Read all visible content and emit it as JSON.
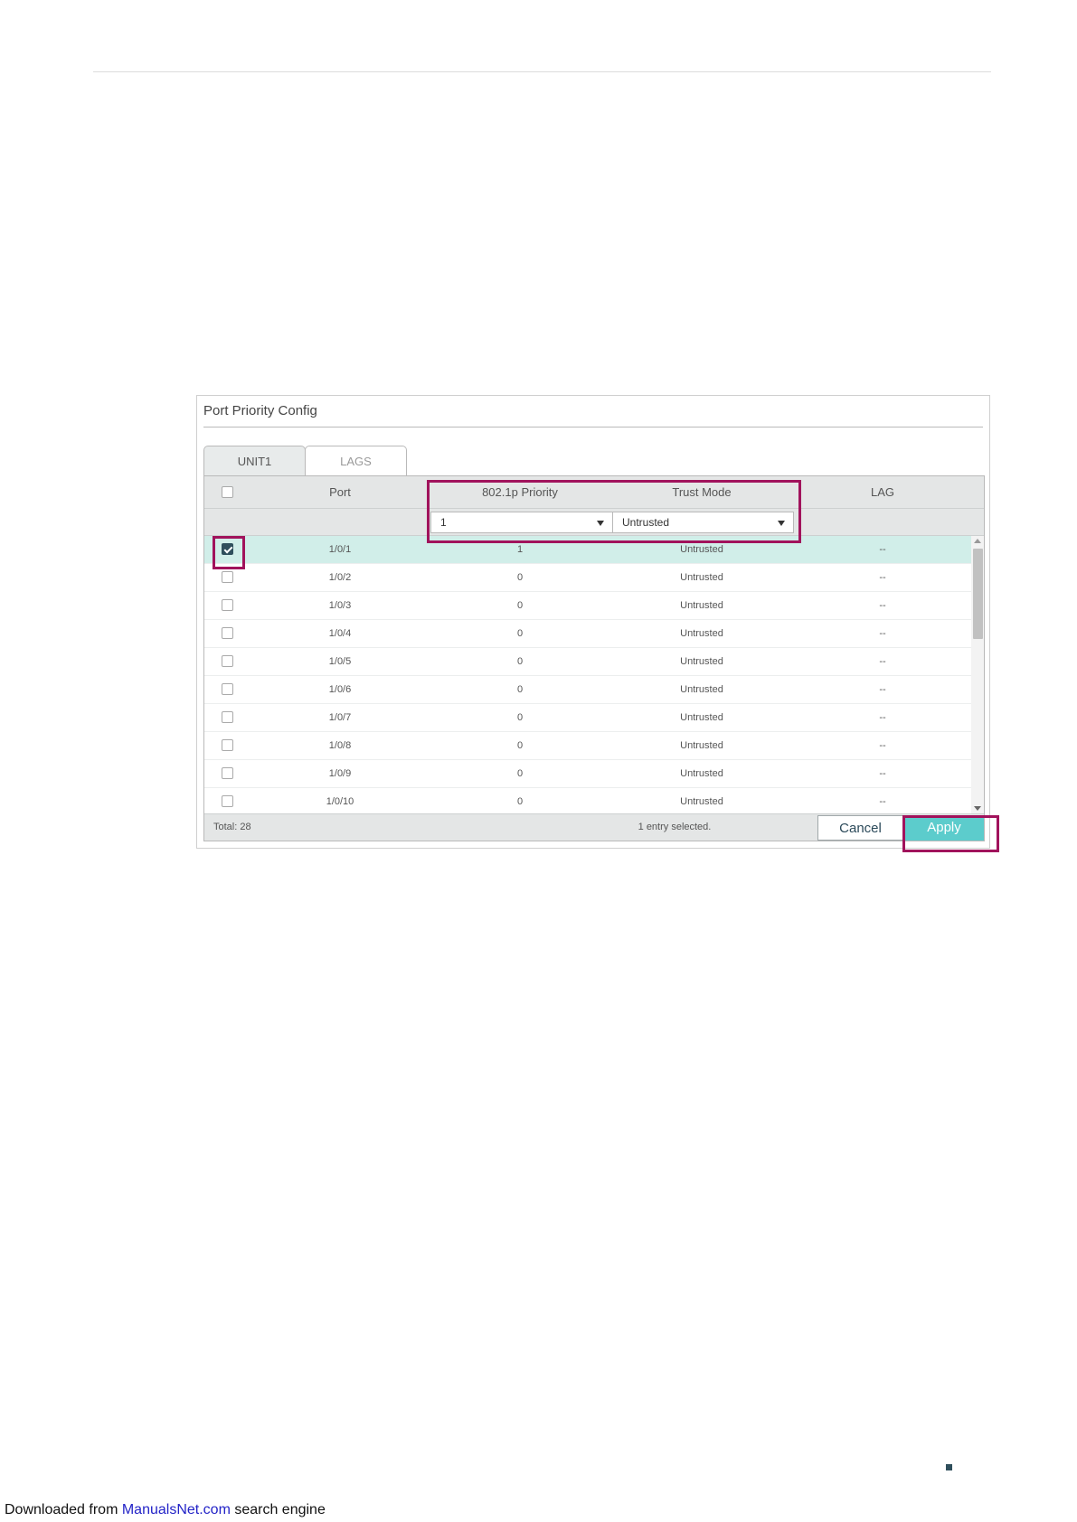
{
  "panel": {
    "title": "Port Priority Config"
  },
  "tabs": [
    {
      "label": "UNIT1",
      "active": true
    },
    {
      "label": "LAGS",
      "active": false
    }
  ],
  "columns": {
    "port": "Port",
    "priority": "802.1p Priority",
    "trust": "Trust Mode",
    "lag": "LAG"
  },
  "filters": {
    "priority": {
      "value": "1"
    },
    "trust": {
      "value": "Untrusted"
    }
  },
  "rows": [
    {
      "checked": true,
      "port": "1/0/1",
      "priority": "1",
      "trust": "Untrusted",
      "lag": "--"
    },
    {
      "checked": false,
      "port": "1/0/2",
      "priority": "0",
      "trust": "Untrusted",
      "lag": "--"
    },
    {
      "checked": false,
      "port": "1/0/3",
      "priority": "0",
      "trust": "Untrusted",
      "lag": "--"
    },
    {
      "checked": false,
      "port": "1/0/4",
      "priority": "0",
      "trust": "Untrusted",
      "lag": "--"
    },
    {
      "checked": false,
      "port": "1/0/5",
      "priority": "0",
      "trust": "Untrusted",
      "lag": "--"
    },
    {
      "checked": false,
      "port": "1/0/6",
      "priority": "0",
      "trust": "Untrusted",
      "lag": "--"
    },
    {
      "checked": false,
      "port": "1/0/7",
      "priority": "0",
      "trust": "Untrusted",
      "lag": "--"
    },
    {
      "checked": false,
      "port": "1/0/8",
      "priority": "0",
      "trust": "Untrusted",
      "lag": "--"
    },
    {
      "checked": false,
      "port": "1/0/9",
      "priority": "0",
      "trust": "Untrusted",
      "lag": "--"
    },
    {
      "checked": false,
      "port": "1/0/10",
      "priority": "0",
      "trust": "Untrusted",
      "lag": "--"
    }
  ],
  "footer": {
    "total": "Total: 28",
    "selected": "1 entry selected.",
    "cancel_label": "Cancel",
    "apply_label": "Apply"
  },
  "footnote": {
    "prefix": "Downloaded from ",
    "link": "ManualsNet.com",
    "suffix": " search engine"
  },
  "colors": {
    "highlight": "#a1135c",
    "apply": "#5ccccc",
    "selected_row": "#d1eee9",
    "checkbox_checked": "#2f4f5c"
  }
}
